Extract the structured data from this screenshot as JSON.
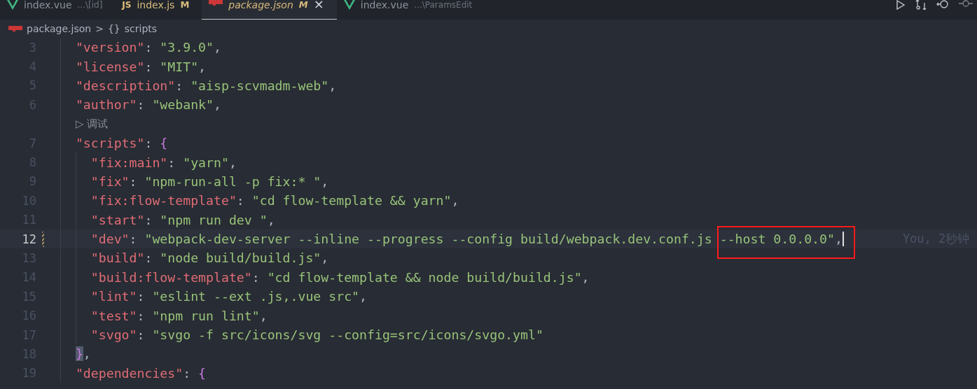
{
  "tabs": [
    {
      "kind": "vue",
      "label": "index.vue",
      "description": "...\\[id]",
      "modified": false,
      "selected": false
    },
    {
      "kind": "js",
      "icon_text": "JS",
      "label": "index.js",
      "badge": "M",
      "modified": true,
      "selected": false
    },
    {
      "kind": "npm",
      "label": "package.json",
      "badge": "M",
      "close": "×",
      "modified": true,
      "selected": true
    },
    {
      "kind": "vue",
      "label": "index.vue",
      "description": "...\\ParamsEdit",
      "modified": false,
      "selected": false
    }
  ],
  "breadcrumb": {
    "file": "package.json",
    "separator": ">",
    "symbol_glyph": "{}",
    "symbol": "scripts"
  },
  "lines": [
    {
      "kind": "code",
      "number": "3",
      "tokens": [
        {
          "kind": "key",
          "text": "\"version\""
        },
        {
          "kind": "punct",
          "text": ": "
        },
        {
          "kind": "string",
          "text": "\"3.9.0\""
        },
        {
          "kind": "punct",
          "text": ","
        }
      ]
    },
    {
      "kind": "code",
      "number": "4",
      "tokens": [
        {
          "kind": "key",
          "text": "\"license\""
        },
        {
          "kind": "punct",
          "text": ": "
        },
        {
          "kind": "string",
          "text": "\"MIT\""
        },
        {
          "kind": "punct",
          "text": ","
        }
      ]
    },
    {
      "kind": "code",
      "number": "5",
      "tokens": [
        {
          "kind": "key",
          "text": "\"description\""
        },
        {
          "kind": "punct",
          "text": ": "
        },
        {
          "kind": "string",
          "text": "\"aisp-scvmadm-web\""
        },
        {
          "kind": "punct",
          "text": ","
        }
      ]
    },
    {
      "kind": "code",
      "number": "6",
      "tokens": [
        {
          "kind": "key",
          "text": "\"author\""
        },
        {
          "kind": "punct",
          "text": ": "
        },
        {
          "kind": "string",
          "text": "\"webank\""
        },
        {
          "kind": "punct",
          "text": ","
        }
      ]
    },
    {
      "kind": "codelens",
      "glyph": "▷",
      "text": "调试"
    },
    {
      "kind": "code",
      "number": "7",
      "tokens": [
        {
          "kind": "key",
          "text": "\"scripts\""
        },
        {
          "kind": "punct",
          "text": ": "
        },
        {
          "kind": "brace",
          "text": "{"
        }
      ],
      "children": [
        {
          "kind": "code",
          "number": "8",
          "tokens": [
            {
              "kind": "key",
              "text": "\"fix:main\""
            },
            {
              "kind": "punct",
              "text": ": "
            },
            {
              "kind": "string",
              "text": "\"yarn\""
            },
            {
              "kind": "punct",
              "text": ","
            }
          ]
        },
        {
          "kind": "code",
          "number": "9",
          "tokens": [
            {
              "kind": "key",
              "text": "\"fix\""
            },
            {
              "kind": "punct",
              "text": ": "
            },
            {
              "kind": "string",
              "text": "\"npm-run-all -p fix:* \""
            },
            {
              "kind": "punct",
              "text": ","
            }
          ]
        },
        {
          "kind": "code",
          "number": "10",
          "tokens": [
            {
              "kind": "key",
              "text": "\"fix:flow-template\""
            },
            {
              "kind": "punct",
              "text": ": "
            },
            {
              "kind": "string",
              "text": "\"cd flow-template && yarn\""
            },
            {
              "kind": "punct",
              "text": ","
            }
          ]
        },
        {
          "kind": "code",
          "number": "11",
          "tokens": [
            {
              "kind": "key",
              "text": "\"start\""
            },
            {
              "kind": "punct",
              "text": ": "
            },
            {
              "kind": "string",
              "text": "\"npm run dev \""
            },
            {
              "kind": "punct",
              "text": ","
            }
          ]
        },
        {
          "kind": "code",
          "number": "12",
          "current": true,
          "changed": true,
          "tokens": [
            {
              "kind": "key",
              "text": "\"dev\""
            },
            {
              "kind": "punct",
              "text": ": "
            },
            {
              "kind": "string",
              "text": "\"webpack-dev-server --inline --progress --config build/webpack.dev.conf.js "
            },
            {
              "kind": "highlight",
              "text": "--host 0.0.0.0\""
            },
            {
              "kind": "highlight_punct",
              "text": ","
            }
          ],
          "blame": "You, 2秒钟"
        },
        {
          "kind": "code",
          "number": "13",
          "tokens": [
            {
              "kind": "key",
              "text": "\"build\""
            },
            {
              "kind": "punct",
              "text": ": "
            },
            {
              "kind": "string",
              "text": "\"node build/build.js\""
            },
            {
              "kind": "punct",
              "text": ","
            }
          ]
        },
        {
          "kind": "code",
          "number": "14",
          "tokens": [
            {
              "kind": "key",
              "text": "\"build:flow-template\""
            },
            {
              "kind": "punct",
              "text": ": "
            },
            {
              "kind": "string",
              "text": "\"cd flow-template && node build/build.js\""
            },
            {
              "kind": "punct",
              "text": ","
            }
          ]
        },
        {
          "kind": "code",
          "number": "15",
          "tokens": [
            {
              "kind": "key",
              "text": "\"lint\""
            },
            {
              "kind": "punct",
              "text": ": "
            },
            {
              "kind": "string",
              "text": "\"eslint --ext .js,.vue src\""
            },
            {
              "kind": "punct",
              "text": ","
            }
          ]
        },
        {
          "kind": "code",
          "number": "16",
          "tokens": [
            {
              "kind": "key",
              "text": "\"test\""
            },
            {
              "kind": "punct",
              "text": ": "
            },
            {
              "kind": "string",
              "text": "\"npm run lint\""
            },
            {
              "kind": "punct",
              "text": ","
            }
          ]
        },
        {
          "kind": "code",
          "number": "17",
          "tokens": [
            {
              "kind": "key",
              "text": "\"svgo\""
            },
            {
              "kind": "punct",
              "text": ": "
            },
            {
              "kind": "string",
              "text": "\"svgo -f src/icons/svg --config=src/icons/svgo.yml\""
            }
          ]
        }
      ]
    },
    {
      "kind": "code",
      "number": "18",
      "tokens": [
        {
          "kind": "brace_match",
          "text": "}"
        },
        {
          "kind": "punct",
          "text": ","
        }
      ]
    },
    {
      "kind": "code",
      "number": "19",
      "tokens": [
        {
          "kind": "key",
          "text": "\"dependencies\""
        },
        {
          "kind": "punct",
          "text": ": "
        },
        {
          "kind": "brace",
          "text": "{"
        }
      ]
    }
  ]
}
